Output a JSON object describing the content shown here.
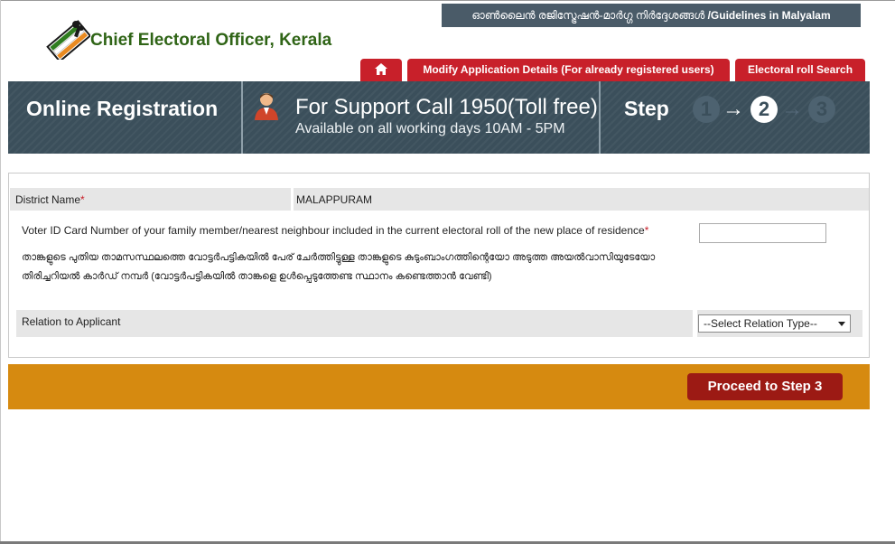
{
  "header": {
    "guidelines_malayalam": "ഓൺലൈൻ രജിസ്ട്രേഷൻ-മാർഗ്ഗ നിർദ്ദേശങ്ങൾ",
    "guidelines_english": "/Guidelines in Malyalam",
    "site_title": "Chief Electoral Officer, Kerala"
  },
  "tabs": {
    "home_icon": "home-icon",
    "modify": "Modify Application Details (For already registered users)",
    "search": "Electoral roll Search"
  },
  "banner": {
    "title": "Online Registration",
    "support_call": "For Support Call 1950(Toll free)",
    "availability": "Available on all working days 10AM - 5PM",
    "step_label": "Step",
    "steps": [
      "1",
      "2",
      "3"
    ],
    "current_step": 2,
    "arrow": "→"
  },
  "form": {
    "district_label": "District Name",
    "required_mark": "*",
    "district_value": "MALAPPURAM",
    "voter_label_en": "Voter ID Card Number of your family member/nearest neighbour included in the current electoral roll of the new place of residence",
    "voter_label_ml": "താങ്കളുടെ പുതിയ താമസസ്ഥലത്തെ വോട്ടർപട്ടികയിൽ പേര് ചേർത്തിട്ടുള്ള താങ്കളുടെ കുടുംബാംഗത്തിന്റെയോ അടുത്ത അയൽവാസിയുടേയോ തിരിച്ചറിയൽ കാർഡ് നമ്പർ (വോട്ടർപട്ടികയിൽ താങ്കളെ ഉൾപ്പെടുത്തേണ്ട സ്ഥാനം കണ്ടെത്താൻ വേണ്ടി)",
    "voter_value": "",
    "relation_label": "Relation to Applicant",
    "relation_selected": "--Select Relation Type--"
  },
  "actions": {
    "proceed": "Proceed to Step 3"
  },
  "colors": {
    "tab_red": "#c8202a",
    "banner_slate": "#3b4f5b",
    "bar_orange": "#d68a10",
    "button_dark_red": "#9c1a14",
    "brand_green": "#2f6416"
  }
}
